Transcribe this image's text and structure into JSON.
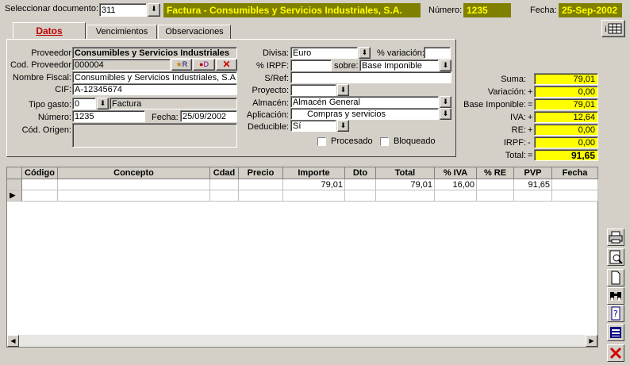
{
  "header": {
    "select_label": "Seleccionar documento:",
    "select_value": "311",
    "doc_title": "Factura - Consumibles y Servicios Industriales, S.A.",
    "numero_label": "Número:",
    "numero_value": "1235",
    "fecha_label": "Fecha:",
    "fecha_value": "25-Sep-2002"
  },
  "tabs": [
    {
      "label": "Datos"
    },
    {
      "label": "Vencimientos"
    },
    {
      "label": "Observaciones"
    }
  ],
  "form": {
    "proveedor_label": "Proveedor",
    "proveedor_value": "Consumibles y Servicios Industriales",
    "cod_proveedor_label": "Cod. Proveedor",
    "cod_proveedor_value": "000004",
    "nombre_fiscal_label": "Nombre Fiscal:",
    "nombre_fiscal_value": "Consumibles y Servicios Industriales, S.A.",
    "cif_label": "CIF:",
    "cif_value": "A-12345674",
    "tipo_gasto_label": "Tipo gasto:",
    "tipo_gasto_value": "0",
    "tipo_gasto_desc": "Factura",
    "numero_label": "Número:",
    "numero_value": "1235",
    "fecha_label": "Fecha:",
    "fecha_value": "25/09/2002",
    "cod_origen_label": "Cód. Origen:",
    "divisa_label": "Divisa:",
    "divisa_value": "Euro",
    "variacion_label": "% variación:",
    "irpf_label": "% IRPF:",
    "sobre_label": "sobre:",
    "sobre_value": "Base Imponible",
    "sref_label": "S/Ref:",
    "proyecto_label": "Proyecto:",
    "almacen_label": "Almacén:",
    "almacen_value": "Almacén General",
    "aplicacion_label": "Aplicación:",
    "aplicacion_value": "Compras y servicios",
    "deducible_label": "Deducible:",
    "deducible_value": "Sí",
    "procesado_label": "Procesado",
    "bloqueado_label": "Bloqueado"
  },
  "totals": [
    {
      "label": "Suma:",
      "sign": "",
      "value": "79,01"
    },
    {
      "label": "Variación:",
      "sign": "+",
      "value": "0,00"
    },
    {
      "label": "Base Imponible:",
      "sign": "=",
      "value": "79,01"
    },
    {
      "label": "IVA:",
      "sign": "+",
      "value": "12,64"
    },
    {
      "label": "RE:",
      "sign": "+",
      "value": "0,00"
    },
    {
      "label": "IRPF:",
      "sign": "-",
      "value": "0,00"
    },
    {
      "label": "Total:",
      "sign": "=",
      "value": "91,65"
    }
  ],
  "grid": {
    "columns": [
      "Código",
      "Concepto",
      "Cdad",
      "Precio",
      "Importe",
      "Dto",
      "Total",
      "% IVA",
      "% RE",
      "PVP",
      "Fecha"
    ],
    "row1": {
      "importe": "79,01",
      "total": "79,01",
      "iva": "16,00",
      "pvp": "91,65"
    }
  },
  "icons": {
    "picker": "gear-icon",
    "print": "printer-icon",
    "preview": "print-preview-icon",
    "new": "new-document-icon",
    "search": "binoculars-icon",
    "help": "help-icon",
    "list": "list-icon",
    "delete": "delete-icon"
  }
}
